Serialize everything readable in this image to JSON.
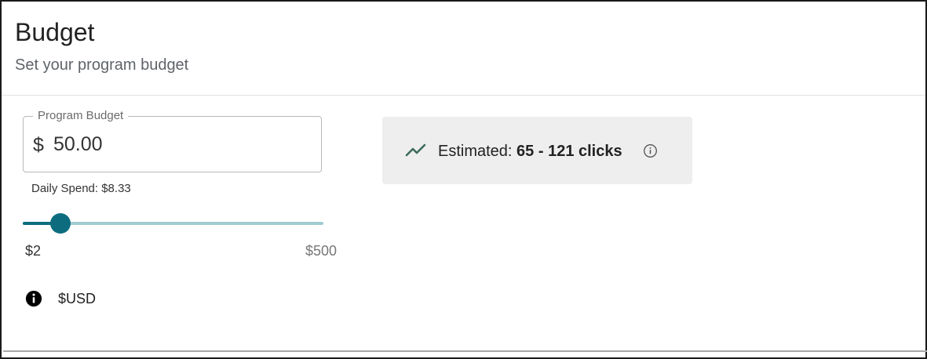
{
  "header": {
    "title": "Budget",
    "subtitle": "Set your program budget"
  },
  "budget_field": {
    "label": "Program Budget",
    "prefix": "$",
    "value": "50.00",
    "helper": "Daily Spend: $8.33"
  },
  "slider": {
    "min_label": "$2",
    "max_label": "$500",
    "min": 2,
    "max": 500,
    "value": 50,
    "track_color": "#0d6d7e",
    "rail_color": "#9fcbd1"
  },
  "currency": {
    "icon": "info-filled-icon",
    "label": "$USD"
  },
  "estimate": {
    "icon": "trending-up-icon",
    "prefix": "Estimated:",
    "value": "65 - 121 clicks",
    "info_icon": "info-outline-icon",
    "background": "#eeeeee"
  }
}
